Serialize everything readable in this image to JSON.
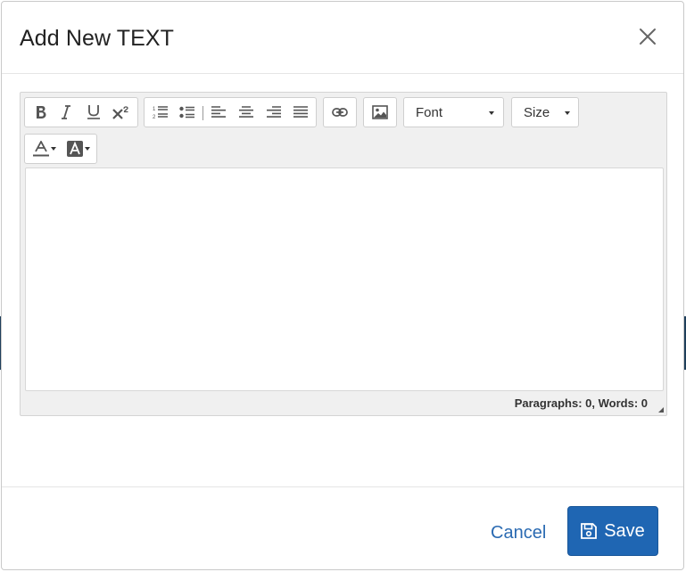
{
  "modal": {
    "title": "Add New TEXT"
  },
  "toolbar": {
    "font_dropdown": "Font",
    "size_dropdown": "Size"
  },
  "editor": {
    "content": "",
    "status": "Paragraphs: 0, Words: 0"
  },
  "footer": {
    "cancel_label": "Cancel",
    "save_label": "Save"
  },
  "colors": {
    "primary": "#1f66b3",
    "link": "#2a6ab2",
    "toolbar_bg": "#f0f0f0"
  },
  "icons": [
    "close-icon",
    "bold-icon",
    "italic-icon",
    "underline-icon",
    "superscript-icon",
    "ordered-list-icon",
    "unordered-list-icon",
    "align-left-icon",
    "align-center-icon",
    "align-right-icon",
    "align-justify-icon",
    "link-icon",
    "image-icon",
    "font-color-icon",
    "background-color-icon",
    "save-icon"
  ]
}
